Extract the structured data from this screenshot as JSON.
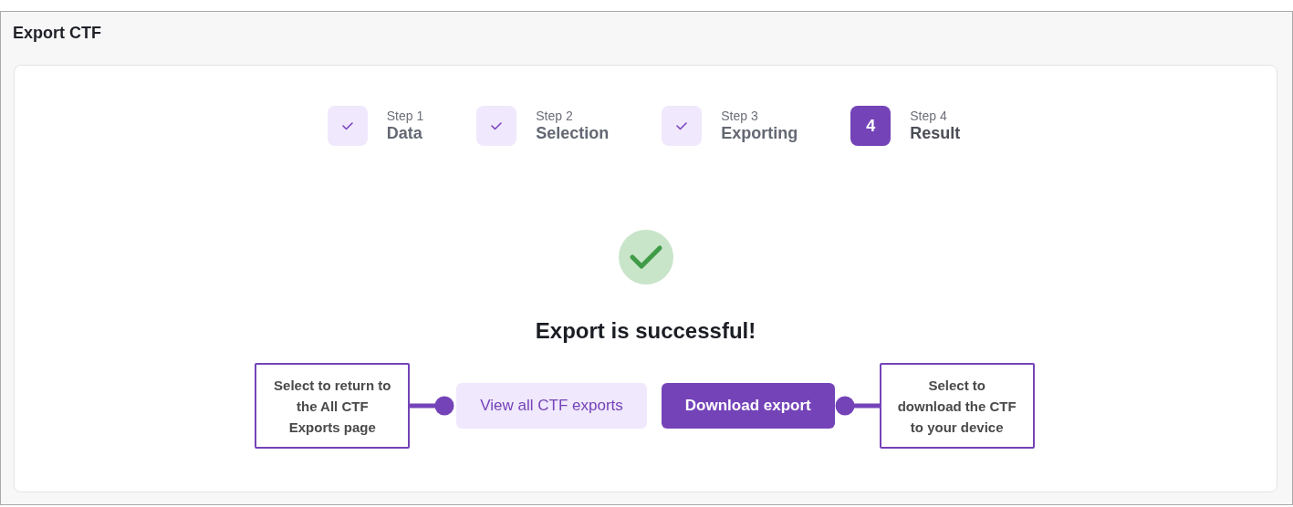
{
  "window": {
    "title": "Export CTF"
  },
  "steps": [
    {
      "caption": "Step 1",
      "label": "Data",
      "completed": true,
      "selected": false
    },
    {
      "caption": "Step 2",
      "label": "Selection",
      "completed": true,
      "selected": false
    },
    {
      "caption": "Step 3",
      "label": "Exporting",
      "completed": true,
      "selected": false
    },
    {
      "caption": "Step 4",
      "label": "Result",
      "completed": false,
      "selected": true,
      "badge": "4"
    }
  ],
  "result": {
    "message": "Export is successful!",
    "success": true
  },
  "buttons": [
    {
      "label": "View all CTF exports",
      "kind": "secondary"
    },
    {
      "label": "Download export",
      "kind": "primary"
    }
  ],
  "callouts": [
    {
      "text": "Select to return to the All CTF Exports page"
    },
    {
      "text": "Select to download the CTF to your device"
    }
  ]
}
